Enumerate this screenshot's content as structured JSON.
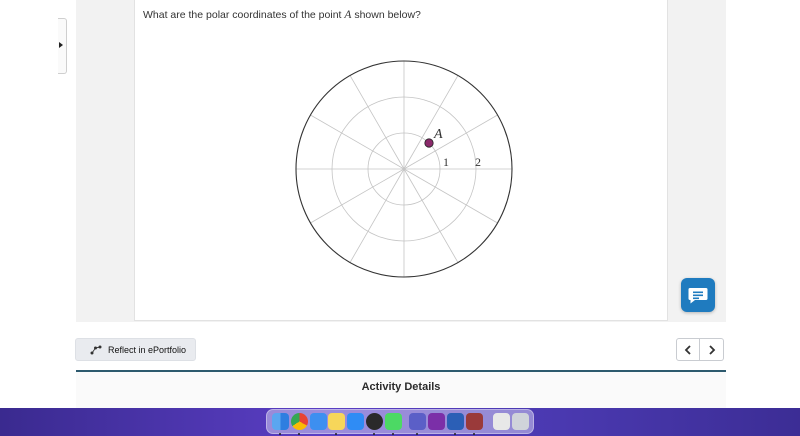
{
  "question": {
    "prefix": "What are the polar coordinates of the point ",
    "variable": "A",
    "suffix": " shown below?"
  },
  "polar_plot": {
    "point_label": "A",
    "radius_labels": [
      "1",
      "2"
    ],
    "point_color": "#8b2a6b"
  },
  "buttons": {
    "reflect_label": "Reflect in ePortfolio",
    "chat_icon": "chat-icon",
    "prev_icon": "chevron-left-icon",
    "next_icon": "chevron-right-icon"
  },
  "activity_details": {
    "title": "Activity Details"
  },
  "dock": {
    "apps": [
      "finder",
      "chrome",
      "mail",
      "notes",
      "app-store",
      "chatgpt",
      "messages",
      "teams",
      "onenote",
      "word",
      "dictionary",
      "preview",
      "trash"
    ]
  },
  "colors": {
    "accent": "#1f7bbf",
    "activity_border": "#2d5a6e"
  }
}
